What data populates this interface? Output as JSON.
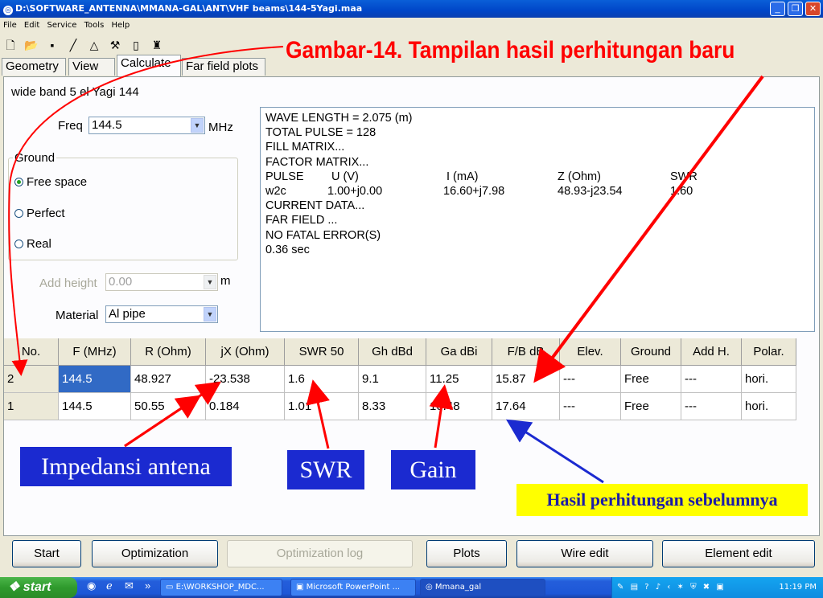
{
  "window": {
    "title": "D:\\SOFTWARE_ANTENNA\\MMANA-GAL\\ANT\\VHF beams\\144-5Yagi.maa",
    "minimize_glyph": "_",
    "maximize_glyph": "❐",
    "close_glyph": "✕"
  },
  "menu": [
    "File",
    "Edit",
    "Service",
    "Tools",
    "Help"
  ],
  "toolbar_icons": [
    "new-file-icon",
    "open-folder-icon",
    "save-icon",
    "line-tool-icon",
    "triangle-tool-icon",
    "hammer-tool-icon",
    "notes-icon",
    "antenna-icon"
  ],
  "tabs": [
    "Geometry",
    "View",
    "Calculate",
    "Far field plots"
  ],
  "active_tab": "Calculate",
  "calculate": {
    "antenna_name": "wide band 5 el Yagi 144",
    "freq_label": "Freq",
    "freq_value": "144.5",
    "freq_unit": "MHz",
    "ground_label": "Ground",
    "ground_options": [
      "Free space",
      "Perfect",
      "Real"
    ],
    "ground_selected": "Free space",
    "add_height_label": "Add height",
    "add_height_value": "0.00",
    "add_height_unit": "m",
    "material_label": "Material",
    "material_value": "Al pipe"
  },
  "output": {
    "wave_length": "WAVE LENGTH = 2.075 (m)",
    "total_pulse": "TOTAL PULSE = 128",
    "fill_matrix": "FILL MATRIX...",
    "factor_matrix": "FACTOR MATRIX...",
    "pulse_header": [
      "PULSE",
      "U (V)",
      "I (mA)",
      "Z (Ohm)",
      "SWR"
    ],
    "pulse_row": [
      "w2c",
      "1.00+j0.00",
      "16.60+j7.98",
      "48.93-j23.54",
      "1.60"
    ],
    "current_data": "CURRENT DATA...",
    "far_field": "FAR FIELD ...",
    "no_error": "NO FATAL ERROR(S)",
    "time": "0.36 sec"
  },
  "table": {
    "columns": [
      "No.",
      "F (MHz)",
      "R (Ohm)",
      "jX (Ohm)",
      "SWR 50",
      "Gh dBd",
      "Ga dBi",
      "F/B dB",
      "Elev.",
      "Ground",
      "Add H.",
      "Polar."
    ],
    "rows": [
      [
        "2",
        "144.5",
        "48.927",
        "-23.538",
        "1.6",
        "9.1",
        "11.25",
        "15.87",
        "---",
        "Free",
        "---",
        "hori."
      ],
      [
        "1",
        "144.5",
        "50.55",
        "0.184",
        "1.01",
        "8.33",
        "10.48",
        "17.64",
        "---",
        "Free",
        "---",
        "hori."
      ]
    ]
  },
  "buttons": [
    "Start",
    "Optimization",
    "Optimization log",
    "Plots",
    "Wire edit",
    "Element edit"
  ],
  "annotations": {
    "title": "Gambar-14. Tampilan hasil perhitungan baru",
    "impedance": "Impedansi antena",
    "swr": "SWR",
    "gain": "Gain",
    "previous": "Hasil perhitungan sebelumnya",
    "red": "#ff0000",
    "blue_box": "#1b2ad0",
    "yellow_box": "#ffff00"
  },
  "taskbar": {
    "start": "start",
    "tasks": [
      "E:\\WORKSHOP_MDC...",
      "Microsoft PowerPoint ...",
      "Mmana_gal"
    ],
    "clock": "11:19 PM"
  }
}
